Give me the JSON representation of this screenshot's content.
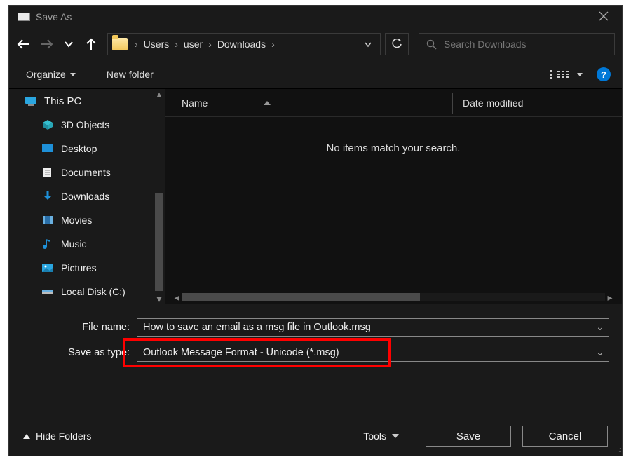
{
  "window": {
    "title": "Save As"
  },
  "nav": {
    "breadcrumbs": [
      "Users",
      "user",
      "Downloads"
    ]
  },
  "search": {
    "placeholder": "Search Downloads"
  },
  "toolbar": {
    "organize": "Organize",
    "new_folder": "New folder"
  },
  "sidebar": {
    "root": "This PC",
    "items": [
      "3D Objects",
      "Desktop",
      "Documents",
      "Downloads",
      "Movies",
      "Music",
      "Pictures",
      "Local Disk (C:)"
    ]
  },
  "columns": {
    "name": "Name",
    "date": "Date modified"
  },
  "content": {
    "empty_message": "No items match your search."
  },
  "form": {
    "filename_label": "File name:",
    "filename_value": "How to save an email as a msg file in Outlook.msg",
    "type_label": "Save as type:",
    "type_value": "Outlook Message Format - Unicode (*.msg)"
  },
  "actions": {
    "hide_folders": "Hide Folders",
    "tools": "Tools",
    "save": "Save",
    "cancel": "Cancel"
  }
}
